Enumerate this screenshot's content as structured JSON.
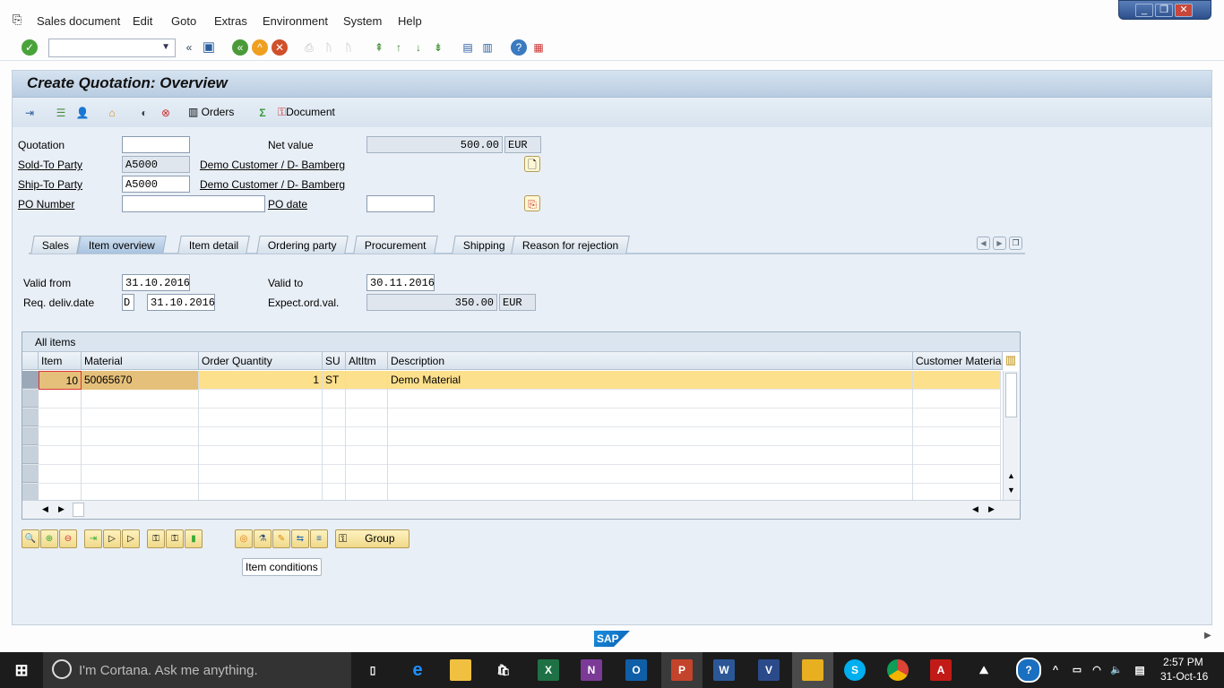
{
  "menu": {
    "items": [
      "Sales document",
      "Edit",
      "Goto",
      "Extras",
      "Environment",
      "System",
      "Help"
    ]
  },
  "toolbar": {
    "command_field": ""
  },
  "screen": {
    "title": "Create Quotation: Overview"
  },
  "app_toolbar": {
    "orders": "Orders",
    "document": "Document"
  },
  "header": {
    "quotation_label": "Quotation",
    "quotation_value": "",
    "sold_to_label": "Sold-To Party",
    "sold_to_value": "A5000",
    "sold_to_name": "Demo Customer / D- Bamberg",
    "ship_to_label": "Ship-To Party",
    "ship_to_value": "A5000",
    "ship_to_name": "Demo Customer / D- Bamberg",
    "po_number_label": "PO Number",
    "po_number_value": "",
    "net_value_label": "Net value",
    "net_value": "500.00",
    "net_currency": "EUR",
    "po_date_label": "PO date",
    "po_date_value": ""
  },
  "tabs": [
    "Sales",
    "Item overview",
    "Item detail",
    "Ordering party",
    "Procurement",
    "Shipping",
    "Reason for rejection"
  ],
  "active_tab": "Item overview",
  "item_overview": {
    "valid_from_label": "Valid from",
    "valid_from": "31.10.2016",
    "valid_to_label": "Valid to",
    "valid_to": "30.11.2016",
    "req_deliv_label": "Req. deliv.date",
    "req_deliv_type": "D",
    "req_deliv_date": "31.10.2016",
    "expect_label": "Expect.ord.val.",
    "expect_value": "350.00",
    "expect_currency": "EUR"
  },
  "items_table": {
    "title": "All items",
    "columns": [
      "Item",
      "Material",
      "Order Quantity",
      "SU",
      "AltItm",
      "Description",
      "Customer Material"
    ],
    "rows": [
      [
        "10",
        "50065670",
        "1",
        "ST",
        "",
        "Demo Material",
        ""
      ]
    ]
  },
  "bottom": {
    "group_label": "Group",
    "tooltip": "Item conditions"
  },
  "colors": {
    "selected_row": "#fde08c",
    "title_bar": "#c6d7ea",
    "panel": "#e9eff6"
  },
  "taskbar": {
    "cortana": "I'm Cortana. Ask me anything.",
    "time": "2:57 PM",
    "date": "31-Oct-16"
  }
}
